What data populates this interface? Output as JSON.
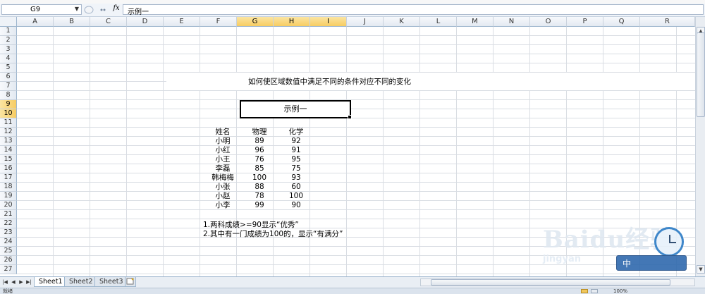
{
  "formula_bar": {
    "name_box": "G9",
    "fx_label": "fx",
    "content": "示例一"
  },
  "columns": [
    "A",
    "B",
    "C",
    "D",
    "E",
    "F",
    "G",
    "H",
    "I",
    "J",
    "K",
    "L",
    "M",
    "N",
    "O",
    "P",
    "Q",
    "R"
  ],
  "selected_columns": [
    "G",
    "H",
    "I"
  ],
  "rows": [
    "1",
    "2",
    "3",
    "4",
    "5",
    "6",
    "7",
    "8",
    "9",
    "10",
    "11",
    "12",
    "13",
    "14",
    "15",
    "16",
    "17",
    "18",
    "19",
    "20",
    "21",
    "22",
    "23",
    "24",
    "25",
    "26",
    "27"
  ],
  "selected_rows": [
    "9",
    "10"
  ],
  "sheet": {
    "title": "如何使区域数值中满足不同的条件对应不同的变化",
    "example_label": "示例一",
    "table_headers": [
      "姓名",
      "物理",
      "化学"
    ],
    "table_rows": [
      {
        "name": "小明",
        "physics": "89",
        "chemistry": "92"
      },
      {
        "name": "小红",
        "physics": "96",
        "chemistry": "91"
      },
      {
        "name": "小王",
        "physics": "76",
        "chemistry": "95"
      },
      {
        "name": "李磊",
        "physics": "85",
        "chemistry": "75"
      },
      {
        "name": "韩梅梅",
        "physics": "100",
        "chemistry": "93"
      },
      {
        "name": "小张",
        "physics": "88",
        "chemistry": "60"
      },
      {
        "name": "小赵",
        "physics": "78",
        "chemistry": "100"
      },
      {
        "name": "小李",
        "physics": "99",
        "chemistry": "90"
      }
    ],
    "notes": [
      "1.两科成绩>=90显示“优秀”",
      "2.其中有一门成绩为100的，显示“有满分”"
    ]
  },
  "tabs": [
    "Sheet1",
    "Sheet2",
    "Sheet3"
  ],
  "active_tab": "Sheet1",
  "status": {
    "ready": "就绪",
    "zoom": "100%"
  },
  "watermark": {
    "logo": "Baidu经验",
    "site": "jingyan",
    "badge": "中"
  },
  "colors": {
    "header_selected": "#f7cc62",
    "grid_line": "#d9dde3",
    "header_border": "#9eb6ce"
  }
}
